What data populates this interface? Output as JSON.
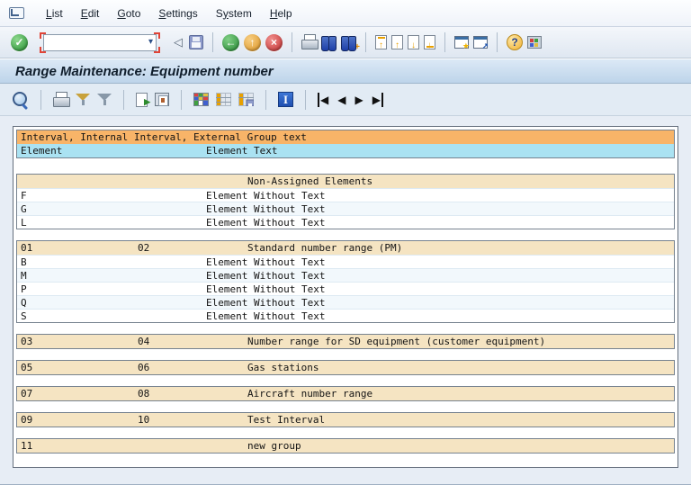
{
  "menubar": {
    "items": [
      {
        "id": "list",
        "pre": "",
        "accel": "L",
        "post": "ist"
      },
      {
        "id": "edit",
        "pre": "",
        "accel": "E",
        "post": "dit"
      },
      {
        "id": "goto",
        "pre": "",
        "accel": "G",
        "post": "oto"
      },
      {
        "id": "settings",
        "pre": "",
        "accel": "S",
        "post": "ettings"
      },
      {
        "id": "system",
        "pre": "S",
        "accel": "y",
        "post": "stem"
      },
      {
        "id": "help",
        "pre": "",
        "accel": "H",
        "post": "elp"
      }
    ]
  },
  "toolbar": {
    "command_value": ""
  },
  "icons": {
    "enter_glyph": "✓",
    "dropdown_glyph": "▾",
    "collapse_glyph": "◁",
    "back_glyph": "←",
    "exit_glyph": "↑",
    "cancel_glyph": "×",
    "find_plus_glyph": "+",
    "page_up_glyph": "↑",
    "page_down_glyph": "↓",
    "star_glyph": "★",
    "shortcut_glyph": "↗",
    "help_glyph": "?",
    "export_glyph": "▶",
    "legend_glyph": "I",
    "prev_glyph": "◀",
    "next_glyph": "▶"
  },
  "titlebar": {
    "title": "Range Maintenance: Equipment number"
  },
  "list": {
    "header_group": "Interval, Internal Interval, External Group text",
    "header_element": "Element",
    "header_element_text": "Element Text",
    "groups": [
      {
        "from": "",
        "to": "",
        "text": "Non-Assigned Elements",
        "elements": [
          {
            "id": "F",
            "text": "Element Without Text"
          },
          {
            "id": "G",
            "text": "Element Without Text"
          },
          {
            "id": "L",
            "text": "Element Without Text"
          }
        ]
      },
      {
        "from": "01",
        "to": "02",
        "text": "Standard number range (PM)",
        "elements": [
          {
            "id": "B",
            "text": "Element Without Text"
          },
          {
            "id": "M",
            "text": "Element Without Text"
          },
          {
            "id": "P",
            "text": "Element Without Text"
          },
          {
            "id": "Q",
            "text": "Element Without Text"
          },
          {
            "id": "S",
            "text": "Element Without Text"
          }
        ]
      },
      {
        "from": "03",
        "to": "04",
        "text": "Number range for SD equipment (customer equipment)",
        "elements": []
      },
      {
        "from": "05",
        "to": "06",
        "text": "Gas stations",
        "elements": []
      },
      {
        "from": "07",
        "to": "08",
        "text": "Aircraft number range",
        "elements": []
      },
      {
        "from": "09",
        "to": "10",
        "text": "Test Interval",
        "elements": []
      },
      {
        "from": "11",
        "to": "",
        "text": "new group",
        "elements": []
      }
    ]
  },
  "colors": {
    "header_orange": "#F8B468",
    "header_cyan": "#AAE2F2",
    "group_beige": "#F5E4C2",
    "row_alt": "#F2F8FC",
    "title_bar_top": "#DCE9F6",
    "title_bar_bottom": "#BDD4EA",
    "enter_green": "#1F8C2C",
    "exit_orange": "#DB9222",
    "cancel_red": "#C02B2C",
    "focus_red": "#E04437"
  }
}
